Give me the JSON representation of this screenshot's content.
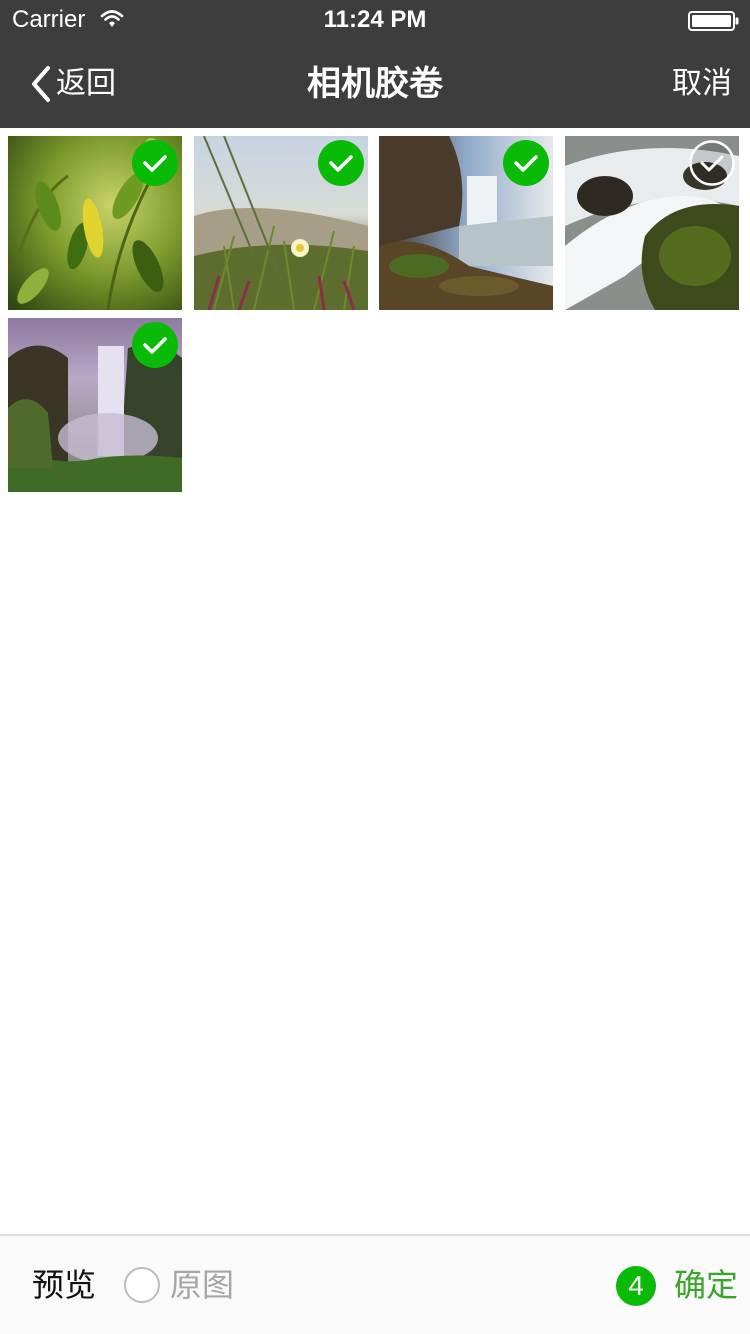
{
  "status_bar": {
    "carrier": "Carrier",
    "time": "11:24 PM",
    "icons": [
      "wifi-icon",
      "battery-icon"
    ]
  },
  "nav": {
    "back_label": "返回",
    "title": "相机胶卷",
    "cancel_label": "取消",
    "icons": [
      "chevron-left-icon"
    ]
  },
  "photos": [
    {
      "subject": "green leaves",
      "selected": true
    },
    {
      "subject": "grass and flower",
      "selected": true
    },
    {
      "subject": "waterfall cliff",
      "selected": true
    },
    {
      "subject": "river rocks",
      "selected": false
    },
    {
      "subject": "tall waterfall",
      "selected": true
    }
  ],
  "toolbar": {
    "preview_label": "预览",
    "original_label": "原图",
    "selected_count": "4",
    "confirm_label": "确定"
  },
  "colors": {
    "nav_bg": "#3d3d3d",
    "accent_green": "#1aad19",
    "confirm_green": "#3aa52b",
    "check_selected": "#09bb07"
  }
}
